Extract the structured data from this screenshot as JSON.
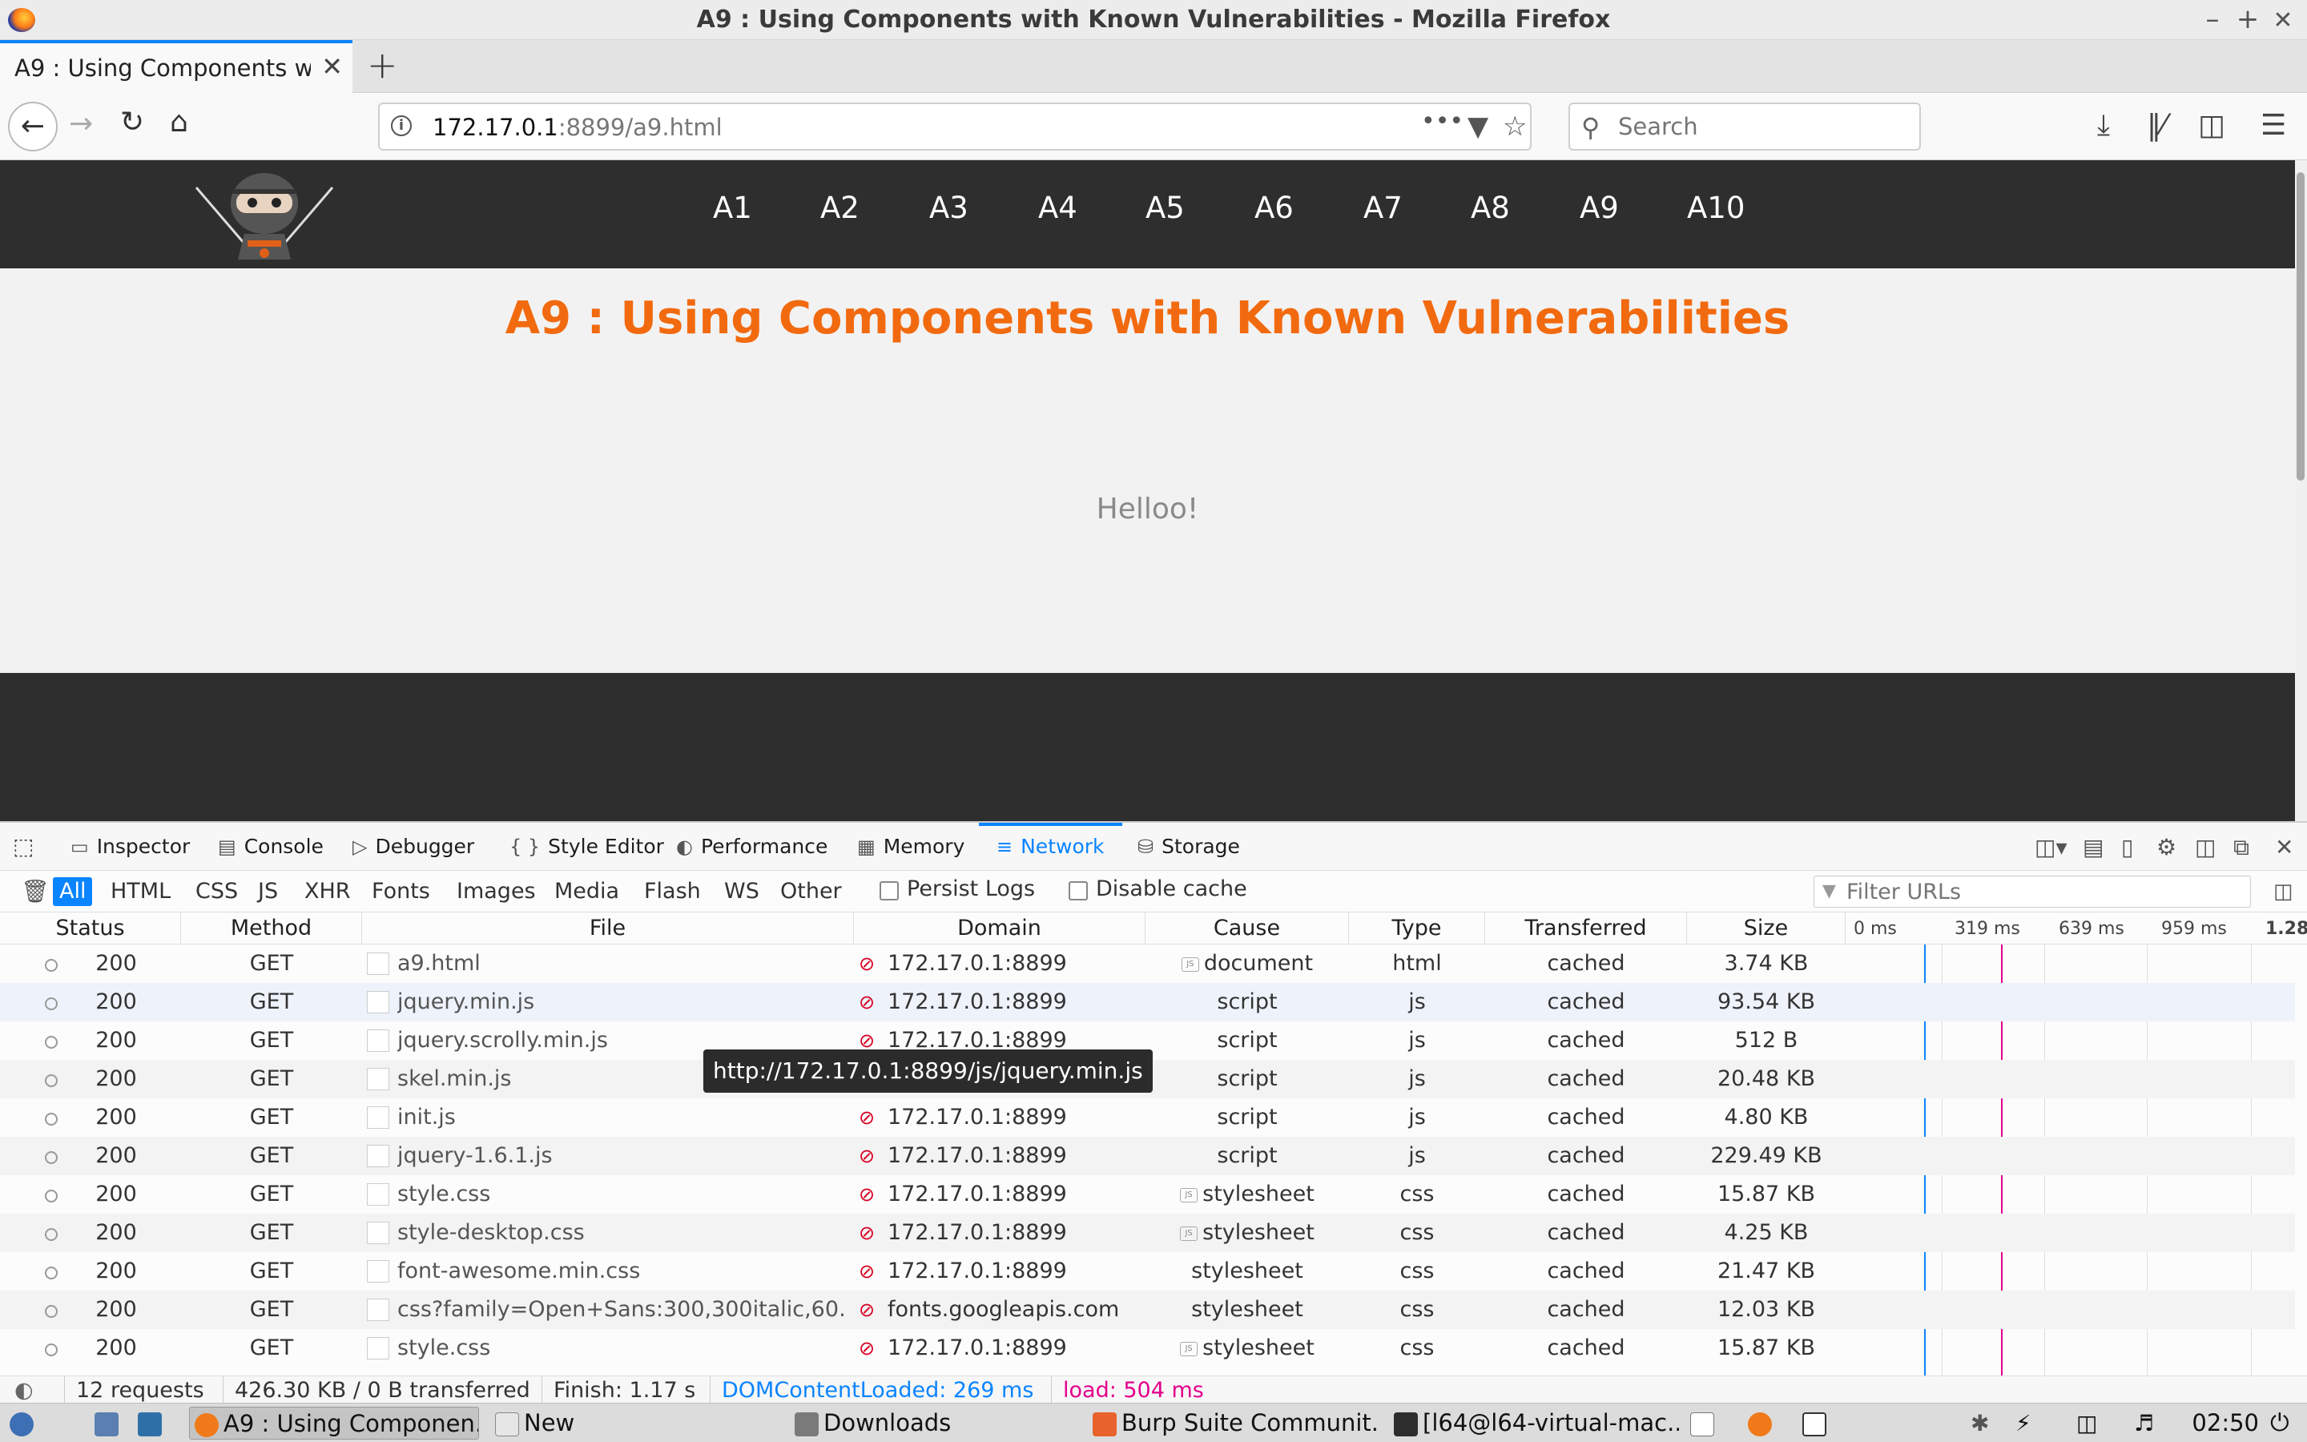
{
  "window": {
    "title": "A9 : Using Components with Known Vulnerabilities - Mozilla Firefox",
    "controls": [
      "–",
      "+",
      "✕"
    ]
  },
  "tab": {
    "title": "A9 : Using Components with Known Vulnerabilities",
    "close": "✕",
    "new_tab": "+"
  },
  "navbar": {
    "url_host": "172.17.0.1",
    "url_path": ":8899/a9.html",
    "page_actions": "•••",
    "search_placeholder": "Search"
  },
  "site": {
    "nav": [
      "A1",
      "A2",
      "A3",
      "A4",
      "A5",
      "A6",
      "A7",
      "A8",
      "A9",
      "A10"
    ],
    "heading": "A9 : Using Components with Known Vulnerabilities",
    "body_text": "Helloo!",
    "heading_color": "#f26a0f"
  },
  "devtools": {
    "tabs": [
      {
        "label": "Inspector",
        "icon": "inspector-icon"
      },
      {
        "label": "Console",
        "icon": "console-icon"
      },
      {
        "label": "Debugger",
        "icon": "debugger-icon"
      },
      {
        "label": "Style Editor",
        "icon": "style-editor-icon"
      },
      {
        "label": "Performance",
        "icon": "performance-icon"
      },
      {
        "label": "Memory",
        "icon": "memory-icon"
      },
      {
        "label": "Network",
        "icon": "network-icon"
      },
      {
        "label": "Storage",
        "icon": "storage-icon"
      }
    ],
    "active_tab": "Network",
    "filter_types": [
      "All",
      "HTML",
      "CSS",
      "JS",
      "XHR",
      "Fonts",
      "Images",
      "Media",
      "Flash",
      "WS",
      "Other"
    ],
    "active_filter": "All",
    "persist_logs": "Persist Logs",
    "disable_cache": "Disable cache",
    "filter_placeholder": "Filter URLs",
    "columns": [
      "Status",
      "Method",
      "File",
      "Domain",
      "Cause",
      "Type",
      "Transferred",
      "Size"
    ],
    "waterfall_ticks": [
      "0 ms",
      "319 ms",
      "639 ms",
      "959 ms",
      "1.28"
    ],
    "requests": [
      {
        "status": "200",
        "method": "GET",
        "file": "a9.html",
        "domain": "172.17.0.1:8899",
        "cause": "document",
        "type": "html",
        "transferred": "cached",
        "size": "3.74 KB"
      },
      {
        "status": "200",
        "method": "GET",
        "file": "jquery.min.js",
        "domain": "172.17.0.1:8899",
        "cause": "script",
        "type": "js",
        "transferred": "cached",
        "size": "93.54 KB"
      },
      {
        "status": "200",
        "method": "GET",
        "file": "jquery.scrolly.min.js",
        "domain": "172.17.0.1:8899",
        "cause": "script",
        "type": "js",
        "transferred": "cached",
        "size": "512 B"
      },
      {
        "status": "200",
        "method": "GET",
        "file": "skel.min.js",
        "domain": "172.17.0.1:8899",
        "cause": "script",
        "type": "js",
        "transferred": "cached",
        "size": "20.48 KB"
      },
      {
        "status": "200",
        "method": "GET",
        "file": "init.js",
        "domain": "172.17.0.1:8899",
        "cause": "script",
        "type": "js",
        "transferred": "cached",
        "size": "4.80 KB"
      },
      {
        "status": "200",
        "method": "GET",
        "file": "jquery-1.6.1.js",
        "domain": "172.17.0.1:8899",
        "cause": "script",
        "type": "js",
        "transferred": "cached",
        "size": "229.49 KB"
      },
      {
        "status": "200",
        "method": "GET",
        "file": "style.css",
        "domain": "172.17.0.1:8899",
        "cause": "stylesheet",
        "type": "css",
        "transferred": "cached",
        "size": "15.87 KB"
      },
      {
        "status": "200",
        "method": "GET",
        "file": "style-desktop.css",
        "domain": "172.17.0.1:8899",
        "cause": "stylesheet",
        "type": "css",
        "transferred": "cached",
        "size": "4.25 KB"
      },
      {
        "status": "200",
        "method": "GET",
        "file": "font-awesome.min.css",
        "domain": "172.17.0.1:8899",
        "cause": "stylesheet",
        "type": "css",
        "transferred": "cached",
        "size": "21.47 KB"
      },
      {
        "status": "200",
        "method": "GET",
        "file": "css?family=Open+Sans:300,300italic,60…",
        "domain": "fonts.googleapis.com",
        "cause": "stylesheet",
        "type": "css",
        "transferred": "cached",
        "size": "12.03 KB"
      },
      {
        "status": "200",
        "method": "GET",
        "file": "style.css",
        "domain": "172.17.0.1:8899",
        "cause": "stylesheet",
        "type": "css",
        "transferred": "cached",
        "size": "15.87 KB"
      }
    ],
    "tooltip": "http://172.17.0.1:8899/js/jquery.min.js",
    "summary": {
      "requests": "12 requests",
      "transferred": "426.30 KB / 0 B transferred",
      "finish": "Finish: 1.17 s",
      "dom_content_loaded": "DOMContentLoaded: 269 ms",
      "load": "load: 504 ms"
    },
    "colors": {
      "accent": "#0a84ff",
      "dom_content_loaded": "#0a84ff",
      "load": "#e3008c"
    }
  },
  "taskbar": {
    "items": [
      "A9 : Using Componen...",
      "New",
      "Downloads",
      "Burp Suite Communit...",
      "[l64@l64-virtual-mac..."
    ],
    "clock": "02:50"
  }
}
